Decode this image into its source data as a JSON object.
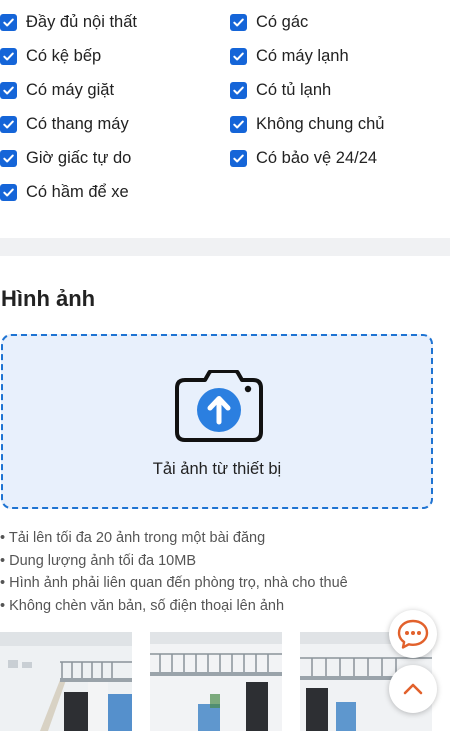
{
  "amenities": [
    {
      "label": "Đầy đủ nội thất",
      "checked": true
    },
    {
      "label": "Có gác",
      "checked": true
    },
    {
      "label": "Có kệ bếp",
      "checked": true
    },
    {
      "label": "Có máy lạnh",
      "checked": true
    },
    {
      "label": "Có máy giặt",
      "checked": true
    },
    {
      "label": "Có tủ lạnh",
      "checked": true
    },
    {
      "label": "Có thang máy",
      "checked": true
    },
    {
      "label": "Không chung chủ",
      "checked": true
    },
    {
      "label": "Giờ giấc tự do",
      "checked": true
    },
    {
      "label": "Có bảo vệ 24/24",
      "checked": true
    },
    {
      "label": "Có hầm để xe",
      "checked": true
    }
  ],
  "images_section": {
    "title": "Hình ảnh",
    "upload_label": "Tải ảnh từ thiết bị",
    "rules": [
      "Tải lên tối đa 20 ảnh trong một bài đăng",
      "Dung lượng ảnh tối đa 10MB",
      "Hình ảnh phải liên quan đến phòng trọ, nhà cho thuê",
      "Không chèn văn bản, số điện thoại lên ảnh"
    ]
  },
  "colors": {
    "accent": "#1565d8",
    "upload_bg": "#e8f0fc",
    "fab_icon": "#e2612c"
  },
  "icons": {
    "checkbox": "check-icon",
    "upload": "camera-upload-icon",
    "chat": "chat-icon",
    "scroll_top": "chevron-up-icon"
  }
}
